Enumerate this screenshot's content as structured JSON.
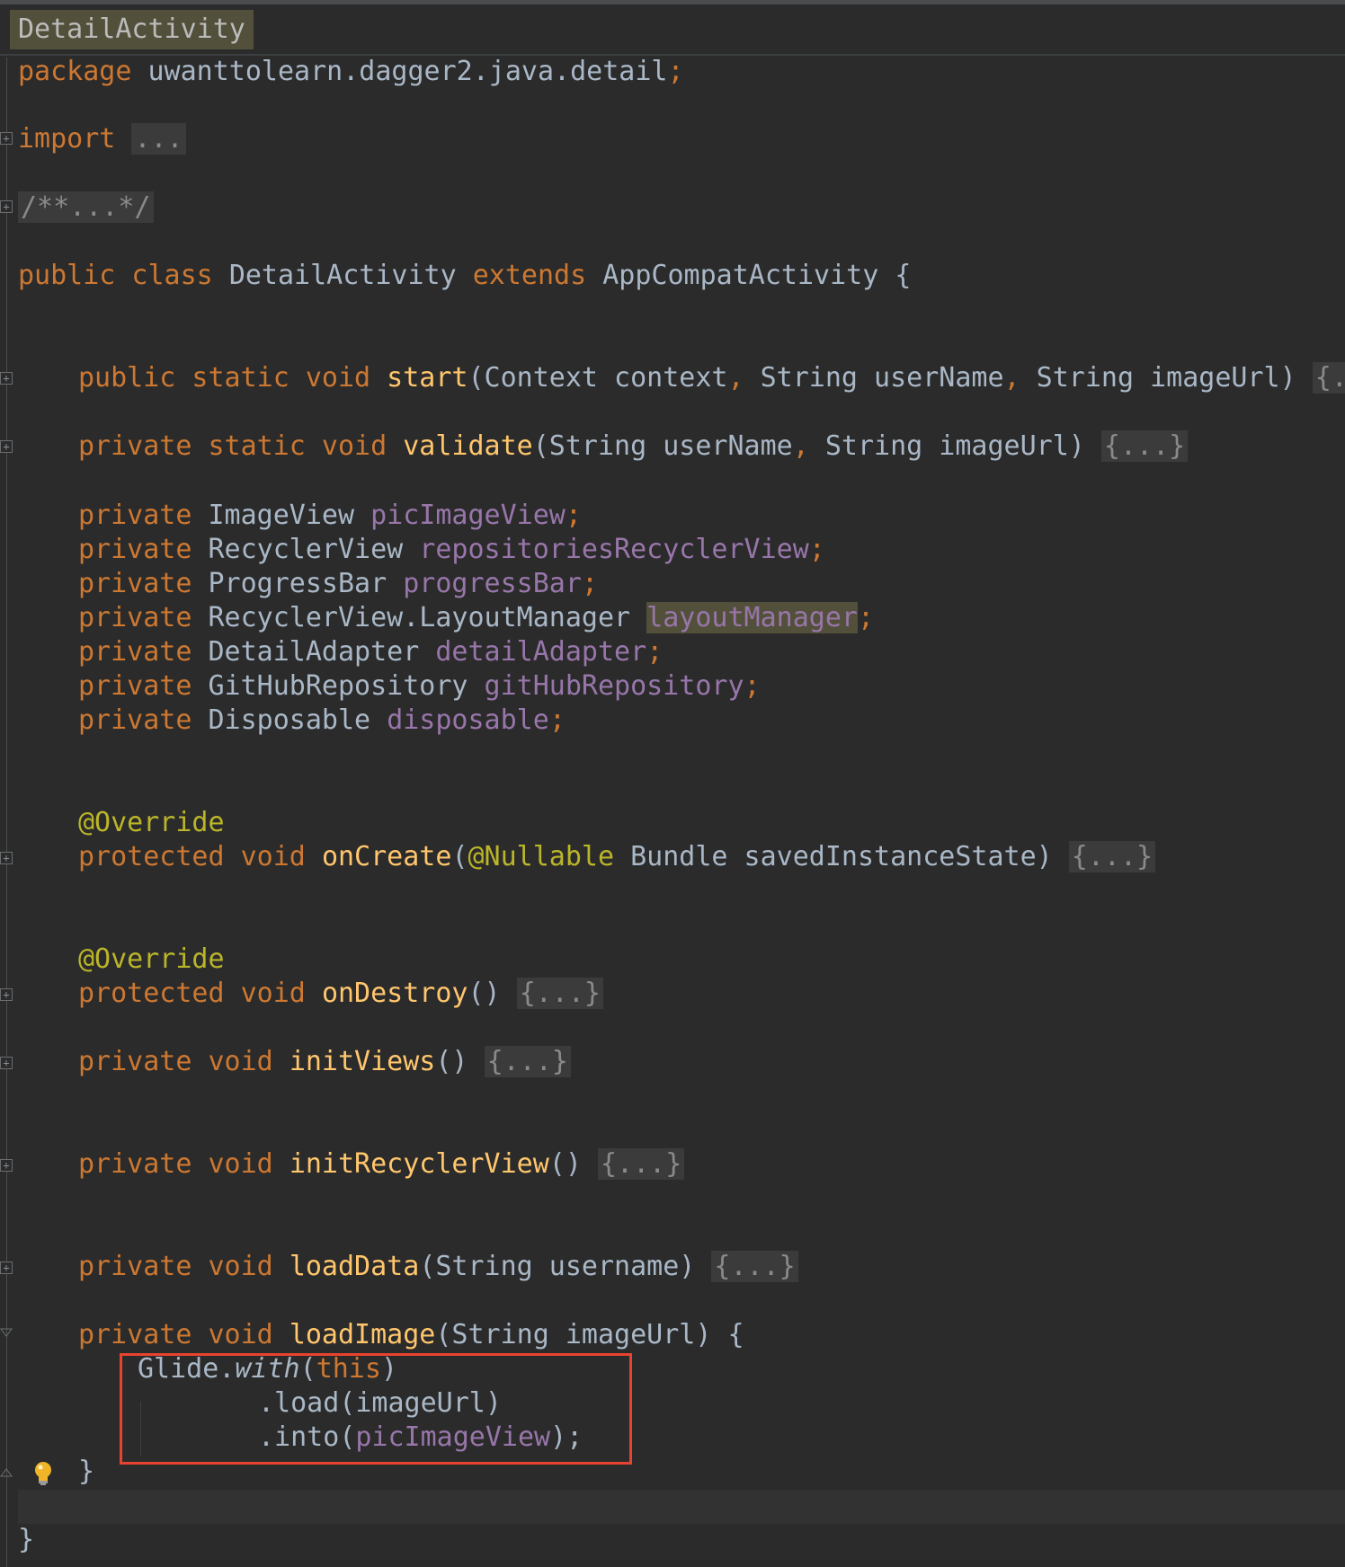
{
  "tab": {
    "title": "DetailActivity"
  },
  "code": {
    "package_kw": "package",
    "package_name": "uwanttolearn.dagger2.java.detail",
    "semicolon": ";",
    "import_kw": "import",
    "import_collapsed": "...",
    "doc_collapsed": "/**...*/",
    "class_decl": {
      "mod": "public class",
      "name": "DetailActivity",
      "extends_kw": "extends",
      "parent": "AppCompatActivity",
      "brace": "{"
    },
    "start": {
      "mods": "public static void",
      "name": "start",
      "params": "(Context context",
      "params2": " String userName",
      "params3": " String imageUrl)",
      "comma": ",",
      "collapsed": "{...}"
    },
    "validate": {
      "mods": "private static void",
      "name": "validate",
      "params": "(String userName",
      "params2": " String imageUrl)",
      "comma": ",",
      "collapsed": "{...}"
    },
    "fields": [
      {
        "mod": "private",
        "type": "ImageView",
        "name": "picImageView"
      },
      {
        "mod": "private",
        "type": "RecyclerView",
        "name": "repositoriesRecyclerView"
      },
      {
        "mod": "private",
        "type": "ProgressBar",
        "name": "progressBar"
      },
      {
        "mod": "private",
        "type": "RecyclerView.LayoutManager",
        "name": "layoutManager"
      },
      {
        "mod": "private",
        "type": "DetailAdapter",
        "name": "detailAdapter"
      },
      {
        "mod": "private",
        "type": "GitHubRepository",
        "name": "gitHubRepository"
      },
      {
        "mod": "private",
        "type": "Disposable",
        "name": "disposable"
      }
    ],
    "override_ann": "@Override",
    "on_create": {
      "mods": "protected void",
      "name": "onCreate",
      "open": "(",
      "nullable": "@Nullable",
      "params": " Bundle savedInstanceState)",
      "collapsed": "{...}"
    },
    "on_destroy": {
      "mods": "protected void",
      "name": "onDestroy",
      "params": "()",
      "collapsed": "{...}"
    },
    "init_views": {
      "mods": "private void",
      "name": "initViews",
      "params": "()",
      "collapsed": "{...}"
    },
    "init_recycler": {
      "mods": "private void",
      "name": "initRecyclerView",
      "params": "()",
      "collapsed": "{...}"
    },
    "load_data": {
      "mods": "private void",
      "name": "loadData",
      "params": "(String username)",
      "collapsed": "{...}"
    },
    "load_image": {
      "mods": "private void",
      "name": "loadImage",
      "params": "(String imageUrl) {",
      "glide": "Glide.",
      "with": "with",
      "open_paren": "(",
      "this": "this",
      "close_paren": ")",
      "load_line": ".load(imageUrl)",
      "into_open": ".into(",
      "into_field": "picImageView",
      "into_close": ");",
      "close_brace": "}"
    },
    "class_close": "}"
  },
  "colors": {
    "background": "#2b2b2b",
    "keyword": "#cc7832",
    "function": "#ffc66d",
    "field": "#9876aa",
    "annotation": "#bbb529",
    "text": "#a9b7c6",
    "highlight_box": "#e8432e"
  },
  "icons": {
    "fold": "fold-icon",
    "bulb": "lightbulb-icon"
  }
}
